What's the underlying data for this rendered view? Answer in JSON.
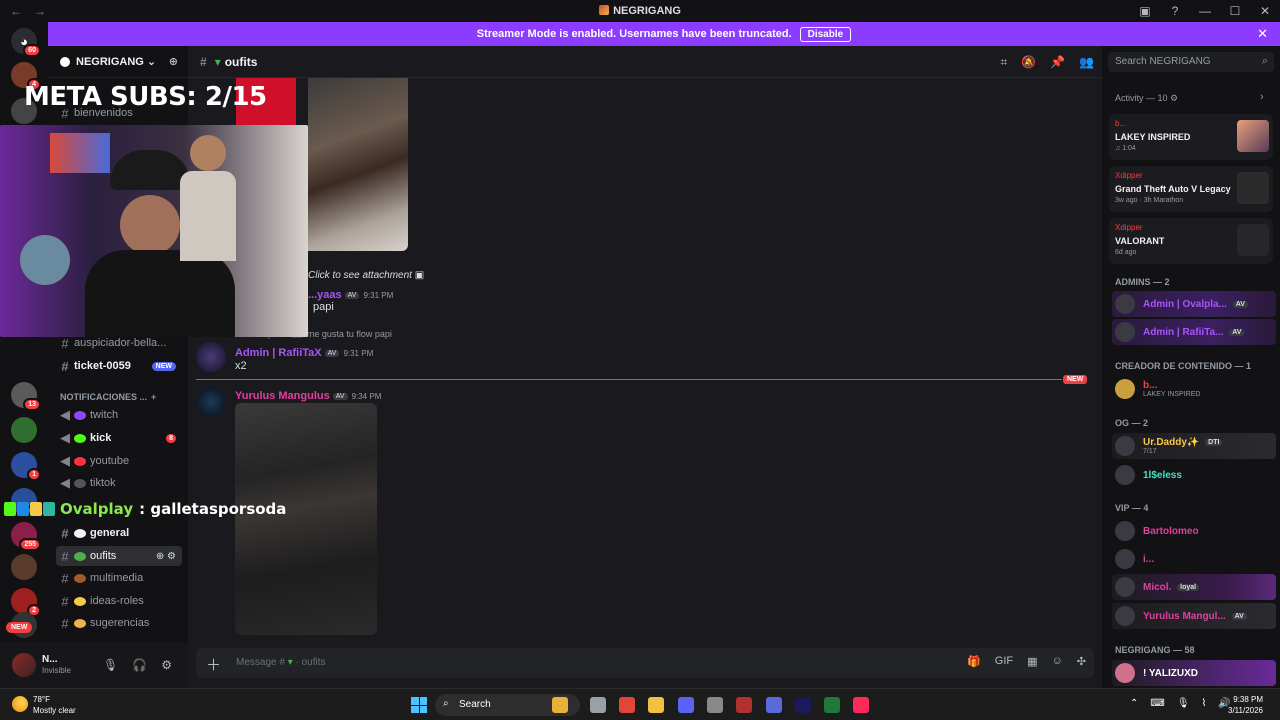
{
  "titlebar": {
    "title": "NEGRIGANG",
    "back": "←",
    "forward": "→",
    "minimize": "—",
    "maximize": "☐",
    "close": "✕",
    "inbox_icon": "inbox-icon",
    "help_icon": "?"
  },
  "banner": {
    "text": "Streamer Mode is enabled. Usernames have been truncated.",
    "button": "Disable",
    "close": "✕"
  },
  "rail": {
    "home_badge": "60",
    "servers": [
      {
        "badge": "4",
        "color": "#7a3a2a"
      },
      {
        "badge": "",
        "color": "#444"
      },
      {
        "badge": "13",
        "color": "#5a5a5a"
      },
      {
        "badge": "",
        "color": "#2f6e2f"
      },
      {
        "badge": "1",
        "color": "#2d4fa0"
      },
      {
        "badge": "2",
        "color": "#2a4f9a"
      },
      {
        "badge": "255",
        "color": "#8b1f4a"
      },
      {
        "badge": "",
        "color": "#5a3a2a"
      },
      {
        "badge": "2",
        "color": "#a02020"
      },
      {
        "badge": "",
        "color": "#333"
      }
    ],
    "new_label": "NEW"
  },
  "server": {
    "name": "NEGRIGANG",
    "chevron": "⌄"
  },
  "sidebar": {
    "partial_channel": "bienvenidos",
    "channels_top": [
      {
        "name": "auspiciador-bella...",
        "badge": ""
      },
      {
        "name": "ticket-0059",
        "badge": "NEW"
      }
    ],
    "category_notif": "NOTIFICACIONES ...",
    "notif_channels": [
      {
        "name": "twitch",
        "color": "#9147ff",
        "badge": ""
      },
      {
        "name": "kick",
        "color": "#53fc18",
        "badge": "8"
      },
      {
        "name": "youtube",
        "color": "#ff3040",
        "badge": ""
      },
      {
        "name": "tiktok",
        "color": "#555",
        "badge": ""
      }
    ],
    "chat_channels": [
      {
        "name": "general",
        "emoji_color": "#f2f3f5"
      },
      {
        "name": "oufits",
        "emoji_color": "#4caf50"
      },
      {
        "name": "multimedia",
        "emoji_color": "#a05a2c"
      },
      {
        "name": "ideas-roles",
        "emoji_color": "#f7c948"
      },
      {
        "name": "sugerencias",
        "emoji_color": "#f0b24c"
      }
    ]
  },
  "user": {
    "name": "N...",
    "status": "Invisible"
  },
  "channel_header": {
    "name": "oufits"
  },
  "search": {
    "placeholder": "Search NEGRIGANG"
  },
  "messages": {
    "attachment_hint": "Click to see attachment",
    "m1_author": "...yaas",
    "m1_time": "9:31 PM",
    "m1_text": "papi",
    "reply_preview_author": "...yaas",
    "reply_preview_text": "me gusta tu flow papi",
    "m2_author": "Admin | RafiiTaX",
    "m2_time": "9:31 PM",
    "m2_text": "x2",
    "new_divider": "NEW",
    "m3_author": "Yurulus Mangulus",
    "m3_time": "9:34 PM",
    "av": "AV"
  },
  "composer": {
    "placeholder": "Message #",
    "channel": "oufits"
  },
  "members": {
    "activity_header": "Activity — 10",
    "activities": [
      {
        "who": "b...",
        "what": "LAKEY INSPIRED",
        "sub": "♫ 1:04"
      },
      {
        "who": "Xdipper",
        "what": "Grand Theft Auto V Legacy",
        "sub": "3w ago  ·  3h Marathon"
      },
      {
        "who": "Xdipper",
        "what": "VALORANT",
        "sub": "6d ago"
      }
    ],
    "groups": [
      {
        "label": "ADMINS — 2"
      },
      {
        "label": "CREADOR DE CONTENIDO — 1"
      },
      {
        "label": "OG — 2"
      },
      {
        "label": "VIP — 4"
      },
      {
        "label": "NEGRIGANG — 58"
      }
    ],
    "admins": [
      "Admin | Ovalpla...",
      "Admin | RafiiTa..."
    ],
    "creator": {
      "name": "b...",
      "status": "LAKEY INSPIRED"
    },
    "og": [
      {
        "name": "Ur.Daddy✨",
        "tag": "DTI",
        "status": "7/17"
      },
      {
        "name": "1l$eless",
        "tag": "",
        "status": ""
      }
    ],
    "vip": [
      {
        "name": "Bartolomeo",
        "tag": ""
      },
      {
        "name": "i...",
        "tag": ""
      },
      {
        "name": "Micol.",
        "tag": "loyal"
      },
      {
        "name": "Yurulus Mangul...",
        "tag": "AV"
      }
    ],
    "negrigang_first": "! YALIZUXD"
  },
  "overlay": {
    "subs": "META SUBS: 2/15",
    "chat_user": "Ovalplay",
    "chat_text": ": galletasporsoda"
  },
  "taskbar": {
    "weather_temp": "78°F",
    "weather_desc": "Mostly clear",
    "search": "Search",
    "time": "9:38 PM",
    "date": "3/11/2026"
  },
  "colors": {
    "brand": "#8c3cff",
    "new_red": "#f23f43",
    "admin_purple": "#a855f7",
    "magenta": "#e040a0"
  }
}
